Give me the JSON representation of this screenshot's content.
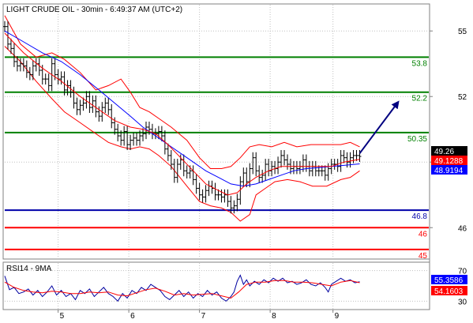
{
  "title": "LIGHT CRUDE OIL - 30min - 6:49:37 AM (UTC+2)",
  "rsi_title": "RSI14 - 9MA",
  "chart_data": [
    {
      "type": "line",
      "title": "LIGHT CRUDE OIL - 30min - 6:49:37 AM (UTC+2)",
      "ylim": [
        44.6,
        56.2
      ],
      "yticks": [
        55,
        52,
        49,
        46
      ],
      "xticks": [
        "5",
        "6",
        "7",
        "8",
        "9"
      ],
      "levels": [
        {
          "value": 53.8,
          "label": "53.8",
          "color": "#008000"
        },
        {
          "value": 52.2,
          "label": "52.2",
          "color": "#008000"
        },
        {
          "value": 50.35,
          "label": "50.35",
          "color": "#008000"
        },
        {
          "value": 46.8,
          "label": "46.8",
          "color": "#0000aa"
        },
        {
          "value": 46,
          "label": "46",
          "color": "#ff0000"
        },
        {
          "value": 45,
          "label": "45",
          "color": "#ff0000"
        }
      ],
      "price_labels": [
        {
          "value": 49.26,
          "label": "49.26",
          "bg": "#000000"
        },
        {
          "value": 49.1288,
          "label": "49.1288",
          "bg": "#ff0000"
        },
        {
          "value": 48.9194,
          "label": "48.9194",
          "bg": "#0000ff"
        }
      ],
      "price": [
        [
          0,
          55.2
        ],
        [
          4,
          54.4
        ],
        [
          8,
          54.2
        ],
        [
          12,
          53.6
        ],
        [
          16,
          53.4
        ],
        [
          20,
          53.5
        ],
        [
          24,
          53.4
        ],
        [
          28,
          53.1
        ],
        [
          32,
          53.0
        ],
        [
          36,
          53.4
        ],
        [
          40,
          53.5
        ],
        [
          44,
          53.2
        ],
        [
          48,
          52.8
        ],
        [
          52,
          52.8
        ],
        [
          56,
          52.5
        ],
        [
          60,
          53.5
        ],
        [
          64,
          53.0
        ],
        [
          68,
          52.8
        ],
        [
          72,
          52.9
        ],
        [
          76,
          52.3
        ],
        [
          80,
          52.5
        ],
        [
          84,
          52.2
        ],
        [
          88,
          51.7
        ],
        [
          92,
          51.4
        ],
        [
          96,
          51.6
        ],
        [
          100,
          51.7
        ],
        [
          104,
          52.0
        ],
        [
          108,
          51.5
        ],
        [
          112,
          51.8
        ],
        [
          116,
          51.3
        ],
        [
          120,
          51.1
        ],
        [
          124,
          51.5
        ],
        [
          128,
          51.7
        ],
        [
          132,
          51.4
        ],
        [
          136,
          50.8
        ],
        [
          140,
          50.5
        ],
        [
          144,
          50.2
        ],
        [
          148,
          50.0
        ],
        [
          152,
          50.4
        ],
        [
          156,
          49.8
        ],
        [
          160,
          50.0
        ],
        [
          164,
          50.1
        ],
        [
          168,
          50.0
        ],
        [
          172,
          50.2
        ],
        [
          176,
          50.3
        ],
        [
          180,
          50.6
        ],
        [
          184,
          50.5
        ],
        [
          188,
          50.3
        ],
        [
          192,
          50.3
        ],
        [
          196,
          50.4
        ],
        [
          200,
          50.2
        ],
        [
          204,
          49.6
        ],
        [
          208,
          49.3
        ],
        [
          212,
          48.9
        ],
        [
          216,
          48.3
        ],
        [
          220,
          48.9
        ],
        [
          224,
          49.1
        ],
        [
          228,
          48.6
        ],
        [
          232,
          48.5
        ],
        [
          236,
          48.6
        ],
        [
          240,
          48.2
        ],
        [
          244,
          47.8
        ],
        [
          248,
          47.5
        ],
        [
          252,
          47.4
        ],
        [
          256,
          47.7
        ],
        [
          260,
          47.9
        ],
        [
          264,
          47.8
        ],
        [
          268,
          47.5
        ],
        [
          272,
          47.5
        ],
        [
          276,
          47.4
        ],
        [
          280,
          47.5
        ],
        [
          284,
          47.2
        ],
        [
          288,
          46.9
        ],
        [
          292,
          47.0
        ],
        [
          296,
          47.3
        ],
        [
          300,
          48.1
        ],
        [
          304,
          48.5
        ],
        [
          308,
          48.1
        ],
        [
          312,
          48.7
        ],
        [
          316,
          49.2
        ],
        [
          320,
          48.6
        ],
        [
          324,
          48.3
        ],
        [
          328,
          48.4
        ],
        [
          332,
          48.9
        ],
        [
          336,
          48.6
        ],
        [
          340,
          48.8
        ],
        [
          344,
          48.7
        ],
        [
          348,
          49.0
        ],
        [
          352,
          49.3
        ],
        [
          356,
          49.1
        ],
        [
          360,
          48.9
        ],
        [
          364,
          48.7
        ],
        [
          368,
          48.8
        ],
        [
          372,
          48.7
        ],
        [
          376,
          48.8
        ],
        [
          380,
          49.1
        ],
        [
          384,
          48.8
        ],
        [
          388,
          48.6
        ],
        [
          392,
          48.8
        ],
        [
          396,
          48.6
        ],
        [
          400,
          48.6
        ],
        [
          404,
          48.6
        ],
        [
          408,
          48.4
        ],
        [
          412,
          48.7
        ],
        [
          416,
          48.9
        ],
        [
          420,
          48.9
        ],
        [
          424,
          48.8
        ],
        [
          428,
          49.3
        ],
        [
          432,
          49.2
        ],
        [
          436,
          49.0
        ],
        [
          440,
          49.2
        ],
        [
          444,
          49.3
        ],
        [
          448,
          49.3
        ],
        [
          452,
          49.26
        ]
      ],
      "bollinger_upper": [
        [
          0,
          55.7
        ],
        [
          20,
          54.4
        ],
        [
          40,
          53.8
        ],
        [
          60,
          54.0
        ],
        [
          76,
          53.7
        ],
        [
          96,
          53.1
        ],
        [
          116,
          52.3
        ],
        [
          132,
          52.5
        ],
        [
          148,
          52.8
        ],
        [
          160,
          52.2
        ],
        [
          172,
          51.5
        ],
        [
          184,
          51.3
        ],
        [
          196,
          51.0
        ],
        [
          212,
          50.6
        ],
        [
          232,
          50.0
        ],
        [
          248,
          49.2
        ],
        [
          262,
          48.7
        ],
        [
          276,
          48.7
        ],
        [
          288,
          48.8
        ],
        [
          300,
          49.2
        ],
        [
          312,
          49.7
        ],
        [
          324,
          49.8
        ],
        [
          340,
          49.7
        ],
        [
          356,
          49.9
        ],
        [
          372,
          49.7
        ],
        [
          390,
          49.8
        ],
        [
          410,
          49.8
        ],
        [
          428,
          49.8
        ],
        [
          440,
          49.9
        ],
        [
          452,
          49.7
        ]
      ],
      "bollinger_lower": [
        [
          0,
          54.3
        ],
        [
          20,
          53.6
        ],
        [
          40,
          52.7
        ],
        [
          60,
          51.9
        ],
        [
          76,
          51.3
        ],
        [
          96,
          50.8
        ],
        [
          116,
          50.3
        ],
        [
          132,
          49.9
        ],
        [
          148,
          49.7
        ],
        [
          160,
          49.6
        ],
        [
          172,
          49.7
        ],
        [
          184,
          49.6
        ],
        [
          196,
          49.3
        ],
        [
          212,
          48.8
        ],
        [
          232,
          47.9
        ],
        [
          248,
          47.2
        ],
        [
          262,
          47.0
        ],
        [
          276,
          46.9
        ],
        [
          288,
          46.7
        ],
        [
          300,
          46.3
        ],
        [
          312,
          46.6
        ],
        [
          320,
          47.5
        ],
        [
          332,
          47.8
        ],
        [
          344,
          48.1
        ],
        [
          360,
          48.2
        ],
        [
          376,
          48.1
        ],
        [
          392,
          47.9
        ],
        [
          410,
          47.9
        ],
        [
          428,
          48.2
        ],
        [
          440,
          48.3
        ],
        [
          452,
          48.6
        ]
      ],
      "ma_red": [
        [
          0,
          54.9
        ],
        [
          24,
          54.0
        ],
        [
          48,
          53.3
        ],
        [
          72,
          52.7
        ],
        [
          96,
          52.0
        ],
        [
          120,
          51.4
        ],
        [
          140,
          50.9
        ],
        [
          160,
          50.6
        ],
        [
          176,
          50.5
        ],
        [
          192,
          50.3
        ],
        [
          208,
          49.8
        ],
        [
          224,
          49.2
        ],
        [
          240,
          48.6
        ],
        [
          256,
          48.0
        ],
        [
          272,
          47.7
        ],
        [
          284,
          47.5
        ],
        [
          296,
          47.6
        ],
        [
          308,
          48.0
        ],
        [
          320,
          48.3
        ],
        [
          336,
          48.6
        ],
        [
          352,
          48.8
        ],
        [
          368,
          48.8
        ],
        [
          384,
          48.8
        ],
        [
          400,
          48.8
        ],
        [
          416,
          48.8
        ],
        [
          432,
          49.0
        ],
        [
          452,
          49.1288
        ]
      ],
      "ma_blue": [
        [
          0,
          55.0
        ],
        [
          24,
          54.5
        ],
        [
          48,
          54.0
        ],
        [
          72,
          53.6
        ],
        [
          96,
          53.0
        ],
        [
          120,
          52.3
        ],
        [
          140,
          51.7
        ],
        [
          160,
          51.1
        ],
        [
          176,
          50.6
        ],
        [
          192,
          50.2
        ],
        [
          208,
          49.8
        ],
        [
          224,
          49.4
        ],
        [
          240,
          49.0
        ],
        [
          256,
          48.6
        ],
        [
          272,
          48.3
        ],
        [
          288,
          48.0
        ],
        [
          304,
          47.9
        ],
        [
          320,
          48.0
        ],
        [
          336,
          48.2
        ],
        [
          352,
          48.4
        ],
        [
          368,
          48.6
        ],
        [
          384,
          48.7
        ],
        [
          400,
          48.75
        ],
        [
          416,
          48.8
        ],
        [
          432,
          48.85
        ],
        [
          452,
          48.9194
        ]
      ],
      "projection": {
        "from": [
          452,
          49.4
        ],
        "to": [
          500,
          51.7
        ]
      }
    },
    {
      "type": "line",
      "title": "RSI14 - 9MA",
      "ylim": [
        20,
        80
      ],
      "yticks": [
        70,
        30
      ],
      "price_labels": [
        {
          "value": 55.3586,
          "label": "55.3586",
          "bg": "#0000ff"
        },
        {
          "value": 54.1603,
          "label": "54.1603",
          "bg": "#ff0000"
        }
      ],
      "rsi": [
        [
          0,
          63
        ],
        [
          6,
          45
        ],
        [
          12,
          48
        ],
        [
          18,
          40
        ],
        [
          24,
          42
        ],
        [
          30,
          46
        ],
        [
          36,
          38
        ],
        [
          42,
          44
        ],
        [
          48,
          36
        ],
        [
          54,
          42
        ],
        [
          60,
          50
        ],
        [
          66,
          38
        ],
        [
          72,
          44
        ],
        [
          78,
          36
        ],
        [
          84,
          40
        ],
        [
          90,
          32
        ],
        [
          96,
          44
        ],
        [
          102,
          40
        ],
        [
          108,
          46
        ],
        [
          114,
          36
        ],
        [
          120,
          42
        ],
        [
          126,
          48
        ],
        [
          132,
          40
        ],
        [
          138,
          36
        ],
        [
          144,
          30
        ],
        [
          150,
          40
        ],
        [
          156,
          34
        ],
        [
          162,
          44
        ],
        [
          168,
          40
        ],
        [
          174,
          48
        ],
        [
          180,
          44
        ],
        [
          186,
          52
        ],
        [
          192,
          48
        ],
        [
          198,
          44
        ],
        [
          204,
          36
        ],
        [
          210,
          32
        ],
        [
          216,
          38
        ],
        [
          222,
          44
        ],
        [
          228,
          36
        ],
        [
          234,
          42
        ],
        [
          240,
          34
        ],
        [
          246,
          40
        ],
        [
          252,
          36
        ],
        [
          258,
          44
        ],
        [
          264,
          38
        ],
        [
          270,
          42
        ],
        [
          276,
          34
        ],
        [
          282,
          30
        ],
        [
          288,
          36
        ],
        [
          292,
          42
        ],
        [
          296,
          56
        ],
        [
          300,
          64
        ],
        [
          304,
          52
        ],
        [
          308,
          58
        ],
        [
          312,
          50
        ],
        [
          318,
          56
        ],
        [
          324,
          52
        ],
        [
          330,
          58
        ],
        [
          336,
          54
        ],
        [
          342,
          60
        ],
        [
          348,
          56
        ],
        [
          354,
          60
        ],
        [
          360,
          54
        ],
        [
          366,
          56
        ],
        [
          372,
          52
        ],
        [
          378,
          54
        ],
        [
          384,
          58
        ],
        [
          390,
          52
        ],
        [
          396,
          50
        ],
        [
          402,
          54
        ],
        [
          408,
          48
        ],
        [
          412,
          42
        ],
        [
          416,
          52
        ],
        [
          422,
          56
        ],
        [
          428,
          60
        ],
        [
          434,
          56
        ],
        [
          440,
          58
        ],
        [
          446,
          54
        ],
        [
          452,
          55.3586
        ]
      ],
      "rsi_ma": [
        [
          0,
          55
        ],
        [
          12,
          48
        ],
        [
          24,
          44
        ],
        [
          36,
          42
        ],
        [
          48,
          41
        ],
        [
          60,
          43
        ],
        [
          72,
          42
        ],
        [
          84,
          40
        ],
        [
          96,
          40
        ],
        [
          108,
          42
        ],
        [
          120,
          41
        ],
        [
          132,
          42
        ],
        [
          144,
          38
        ],
        [
          156,
          37
        ],
        [
          168,
          41
        ],
        [
          180,
          45
        ],
        [
          192,
          47
        ],
        [
          204,
          43
        ],
        [
          216,
          38
        ],
        [
          228,
          40
        ],
        [
          240,
          38
        ],
        [
          252,
          39
        ],
        [
          264,
          40
        ],
        [
          276,
          37
        ],
        [
          288,
          34
        ],
        [
          298,
          42
        ],
        [
          308,
          52
        ],
        [
          320,
          55
        ],
        [
          332,
          55
        ],
        [
          344,
          57
        ],
        [
          356,
          57
        ],
        [
          368,
          55
        ],
        [
          380,
          55
        ],
        [
          392,
          54
        ],
        [
          404,
          52
        ],
        [
          416,
          50
        ],
        [
          428,
          55
        ],
        [
          440,
          57
        ],
        [
          452,
          54.1603
        ]
      ]
    }
  ]
}
